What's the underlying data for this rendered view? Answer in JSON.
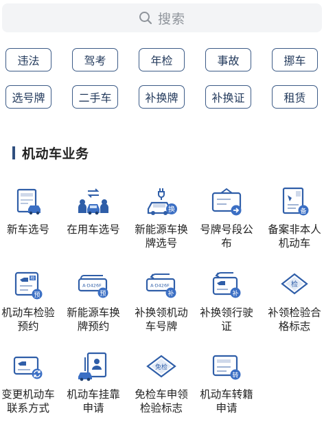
{
  "search": {
    "placeholder": "搜索",
    "icon": "search-icon"
  },
  "quick_tags": [
    {
      "label": "违法"
    },
    {
      "label": "驾考"
    },
    {
      "label": "年检"
    },
    {
      "label": "事故"
    },
    {
      "label": "挪车"
    },
    {
      "label": "选号牌"
    },
    {
      "label": "二手车"
    },
    {
      "label": "补换牌"
    },
    {
      "label": "补换证"
    },
    {
      "label": "租赁"
    }
  ],
  "section": {
    "title": "机动车业务"
  },
  "services": [
    {
      "label": "新车选号",
      "icon": "plate-select-icon"
    },
    {
      "label": "在用车选号",
      "icon": "car-owners-exchange-icon"
    },
    {
      "label": "新能源车换牌选号",
      "icon": "ev-car-icon",
      "badge": "换"
    },
    {
      "label": "号牌号段公布",
      "icon": "plate-announcement-icon"
    },
    {
      "label": "备案非本人机动车",
      "icon": "filing-document-icon",
      "badge": "备"
    },
    {
      "label": "机动车检验预约",
      "icon": "inspection-booking-icon",
      "badge": "预",
      "tag": "检"
    },
    {
      "label": "新能源车换牌预约",
      "icon": "ev-plate-booking-icon",
      "badge": "预",
      "plate_text": "A·D426F"
    },
    {
      "label": "补换领机动车号牌",
      "icon": "plate-replace-icon",
      "badge": "补",
      "plate_text": "A·D426F"
    },
    {
      "label": "补换领行驶证",
      "icon": "license-replace-icon",
      "badge": "补"
    },
    {
      "label": "补领检验合格标志",
      "icon": "inspection-mark-icon",
      "tag": "检"
    },
    {
      "label": "变更机动车联系方式",
      "icon": "contact-change-icon"
    },
    {
      "label": "机动车挂靠申请",
      "icon": "affiliation-apply-icon"
    },
    {
      "label": "免检车申领检验标志",
      "icon": "exempt-mark-icon",
      "tag": "免检"
    },
    {
      "label": "机动车转籍申请",
      "icon": "transfer-apply-icon",
      "badge": "转"
    }
  ],
  "colors": {
    "primary": "#2f5ea8",
    "accent": "#3b6fc4",
    "tag_border": "#3b5a86",
    "search_bg": "#f3f4f6"
  }
}
